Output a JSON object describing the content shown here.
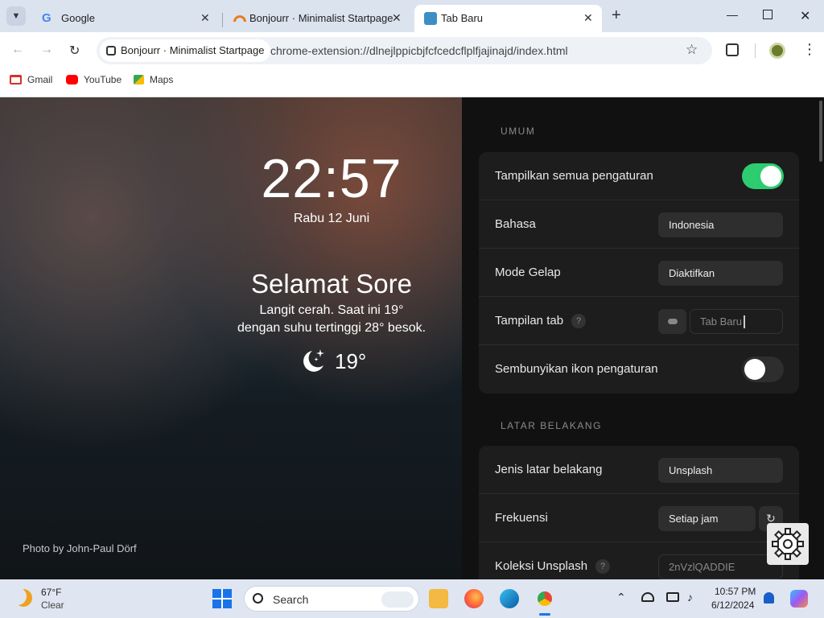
{
  "browser": {
    "tabs": [
      {
        "title": "Google"
      },
      {
        "title": "Bonjourr · Minimalist Startpage"
      },
      {
        "title": "Tab Baru"
      }
    ],
    "chip_label": "Bonjourr · Minimalist Startpage",
    "url": "chrome-extension://dlnejlppicbjfcfcedcflplfjajinajd/index.html",
    "bookmarks": [
      "Gmail",
      "YouTube",
      "Maps"
    ]
  },
  "startpage": {
    "time": "22:57",
    "date": "Rabu 12 Juni",
    "greeting": "Selamat Sore",
    "description_line1": "Langit cerah. Saat ini 19°",
    "description_line2": "dengan suhu tertinggi 28° besok.",
    "weather_temp": "19°",
    "photo_credit": "Photo by John-Paul Dörf"
  },
  "settings": {
    "general_header": "UMUM",
    "show_all_label": "Tampilkan semua pengaturan",
    "show_all_on": true,
    "language_label": "Bahasa",
    "language_value": "Indonesia",
    "dark_mode_label": "Mode Gelap",
    "dark_mode_value": "Diaktifkan",
    "tab_display_label": "Tampilan tab",
    "tab_title_placeholder": "Tab Baru",
    "hide_settings_icon_label": "Sembunyikan ikon pengaturan",
    "hide_settings_icon_on": false,
    "background_header": "LATAR BELAKANG",
    "bg_type_label": "Jenis latar belakang",
    "bg_type_value": "Unsplash",
    "frequency_label": "Frekuensi",
    "frequency_value": "Setiap jam",
    "collection_label": "Koleksi Unsplash",
    "collection_placeholder": "2nVzlQADDIE"
  },
  "taskbar": {
    "weather_temp": "67°F",
    "weather_desc": "Clear",
    "search_placeholder": "Search",
    "time": "10:57 PM",
    "date": "6/12/2024"
  },
  "colors": {
    "toggle_on": "#2ecc71",
    "settings_bg": "#111111",
    "card_bg": "#1d1d1d"
  }
}
